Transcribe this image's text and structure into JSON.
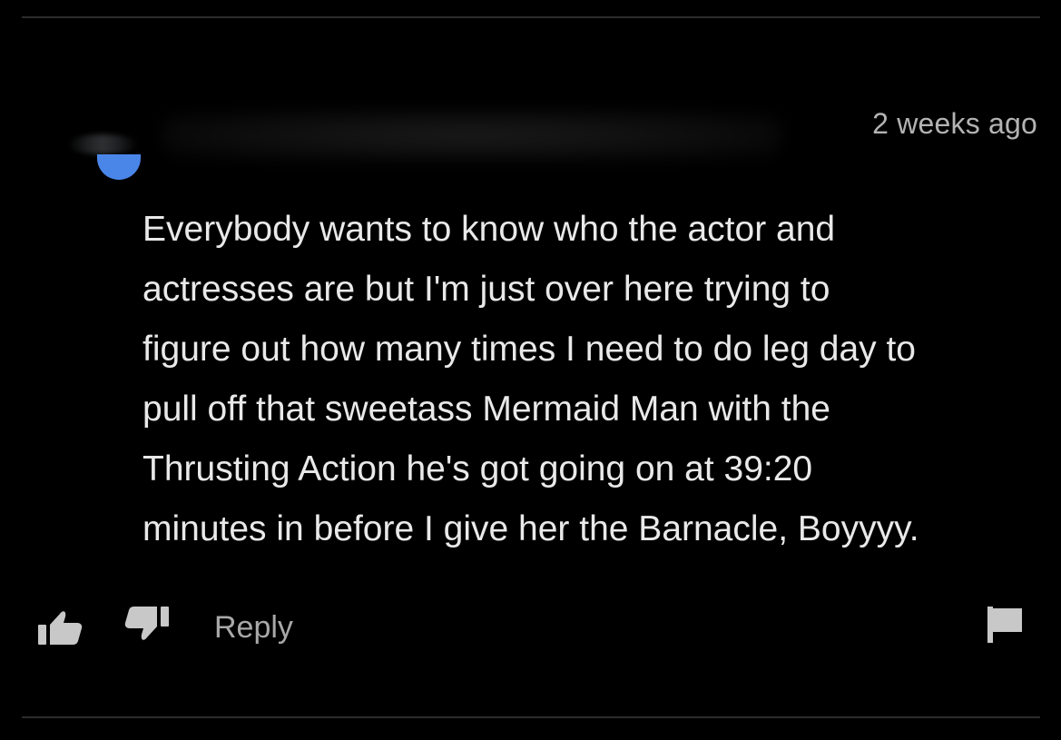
{
  "comment": {
    "timestamp": "2 weeks ago",
    "text": "Everybody wants to know who the actor and\nactresses are but I'm just over here trying to\nfigure out how many times I need to do leg day to\npull off that sweetass Mermaid Man with the\nThrusting Action he's got going on at 39:20\nminutes in before I give her the Barnacle, Boyyyy.",
    "avatar_color": "#4a86e8"
  },
  "actions": {
    "reply_label": "Reply",
    "like_icon": "thumbs-up-icon",
    "dislike_icon": "thumbs-down-icon",
    "flag_icon": "flag-icon"
  },
  "colors": {
    "background": "#000000",
    "text": "#e9e9e9",
    "muted": "#a8a8a8",
    "divider": "#2c2c2c"
  }
}
